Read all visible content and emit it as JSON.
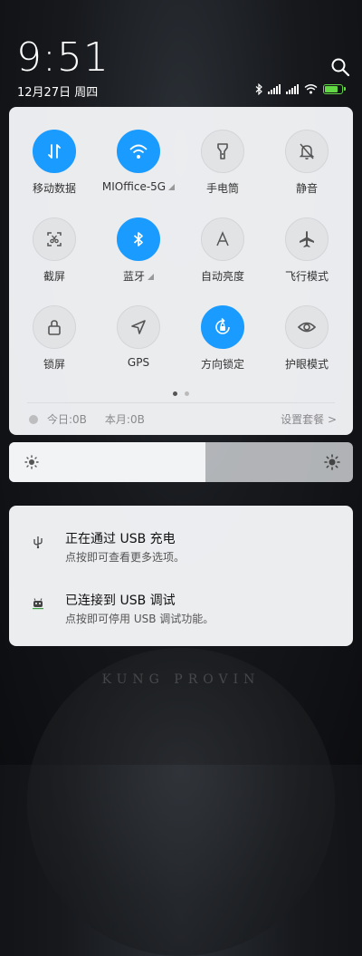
{
  "header": {
    "time": "9:51",
    "date": "12月27日 周四"
  },
  "status_icons": [
    "bluetooth-icon",
    "signal-icon",
    "signal-icon",
    "wifi-icon",
    "battery-charging-icon"
  ],
  "colors": {
    "accent": "#1a9bff",
    "battery": "#62d845"
  },
  "control_center": {
    "tiles": [
      {
        "label": "移动数据",
        "icon": "mobile-data-icon",
        "active": true
      },
      {
        "label": "MIOffice-5G",
        "icon": "wifi-icon",
        "active": true
      },
      {
        "label": "手电筒",
        "icon": "flashlight-icon",
        "active": false
      },
      {
        "label": "静音",
        "icon": "mute-bell-icon",
        "active": false
      },
      {
        "label": "截屏",
        "icon": "screenshot-icon",
        "active": false
      },
      {
        "label": "蓝牙",
        "icon": "bluetooth-icon",
        "active": true
      },
      {
        "label": "自动亮度",
        "icon": "auto-brightness-icon",
        "active": false
      },
      {
        "label": "飞行模式",
        "icon": "airplane-icon",
        "active": false
      },
      {
        "label": "锁屏",
        "icon": "lock-icon",
        "active": false
      },
      {
        "label": "GPS",
        "icon": "gps-icon",
        "active": false
      },
      {
        "label": "方向锁定",
        "icon": "rotation-lock-icon",
        "active": true
      },
      {
        "label": "护眼模式",
        "icon": "eye-icon",
        "active": false
      }
    ],
    "page_count": 2,
    "current_page": 1,
    "data_today": "今日:0B",
    "data_month": "本月:0B",
    "settings_link": "设置套餐 >"
  },
  "brightness": {
    "level": 0.57
  },
  "notifications": [
    {
      "icon": "usb-icon",
      "title": "正在通过 USB 充电",
      "body": "点按即可查看更多选项。"
    },
    {
      "icon": "android-debug-icon",
      "title": "已连接到 USB 调试",
      "body": "点按即可停用 USB 调试功能。"
    }
  ]
}
